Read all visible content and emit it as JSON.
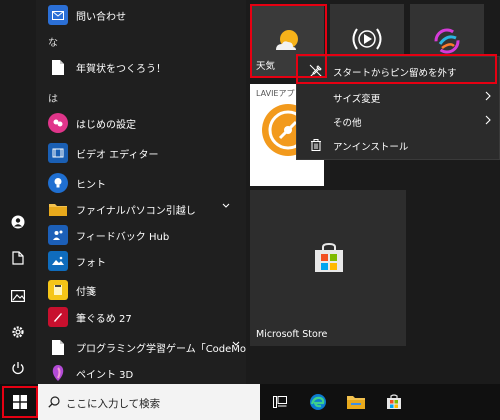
{
  "applist": {
    "top_item": {
      "label": "問い合わせ",
      "icon": "mail-icon"
    },
    "section_na": "な",
    "na_items": [
      {
        "label": "年賀状をつくろう！",
        "icon": "document-icon"
      }
    ],
    "section_ha": "は",
    "ha_items": [
      {
        "label": "はじめの設定",
        "icon": "setup-icon"
      },
      {
        "label": "ビデオ エディター",
        "icon": "video-editor-icon"
      },
      {
        "label": "ヒント",
        "icon": "tips-icon"
      },
      {
        "label": "ファイナルパソコン引越し",
        "icon": "folder-icon",
        "expandable": true
      },
      {
        "label": "フィードバック Hub",
        "icon": "feedback-icon"
      },
      {
        "label": "フォト",
        "icon": "photos-icon"
      },
      {
        "label": "付箋",
        "icon": "sticky-notes-icon"
      },
      {
        "label": "筆ぐるめ 27",
        "icon": "fudegurume-icon"
      },
      {
        "label": "プログラミング学習ゲーム「CodeMonkey」",
        "icon": "document-icon",
        "expandable": true
      },
      {
        "label": "ペイント 3D",
        "icon": "paint3d-icon"
      }
    ]
  },
  "tiles": {
    "weather": {
      "label": "天気",
      "icon": "weather-icon"
    },
    "media": {
      "icon": "media-icon"
    },
    "sketch": {
      "icon": "sketch-icon"
    },
    "lavie": {
      "label": "LAVIEアプリ",
      "icon": "lavie-icon"
    },
    "store": {
      "label": "Microsoft Store",
      "icon": "store-icon"
    }
  },
  "context_menu": {
    "items": [
      {
        "label": "スタートからピン留めを外す",
        "icon": "unpin-icon",
        "submenu": false
      },
      {
        "label": "サイズ変更",
        "icon": "",
        "submenu": true
      },
      {
        "label": "その他",
        "icon": "",
        "submenu": true
      },
      {
        "label": "アンインストール",
        "icon": "trash-icon",
        "submenu": false
      }
    ]
  },
  "taskbar": {
    "search_placeholder": "ここに入力して検索",
    "pinned": [
      "task-view-icon",
      "edge-icon",
      "file-explorer-icon",
      "store-icon"
    ]
  },
  "colors": {
    "highlight": "#e60012",
    "background": "#1b1b1b",
    "menu_bg": "#2b2b2b",
    "tile_weather": "#3a3a3a",
    "tile_store": "#2d2d2d"
  }
}
